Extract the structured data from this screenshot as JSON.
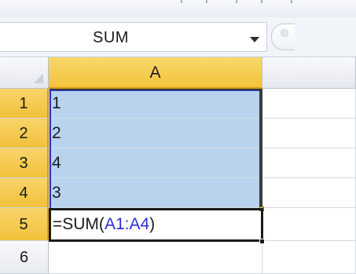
{
  "formula_bar": {
    "name_box_value": "SUM",
    "name_box_arrow_icon": "chevron-down-icon",
    "fx_icon": "insert-function-icon"
  },
  "grid": {
    "column_headers": [
      "A"
    ],
    "row_headers": [
      "1",
      "2",
      "3",
      "4",
      "5",
      "6"
    ],
    "cells": {
      "A1": "1",
      "A2": "2",
      "A3": "4",
      "A4": "3"
    },
    "editing_cell": {
      "prefix": "=SUM(",
      "reference": "A1:A4",
      "suffix": ")"
    },
    "colors": {
      "selected_range_fill": "#b9d3ee",
      "reference_color": "#2f2fd6",
      "active_header_fill": "#f3c33a"
    }
  }
}
